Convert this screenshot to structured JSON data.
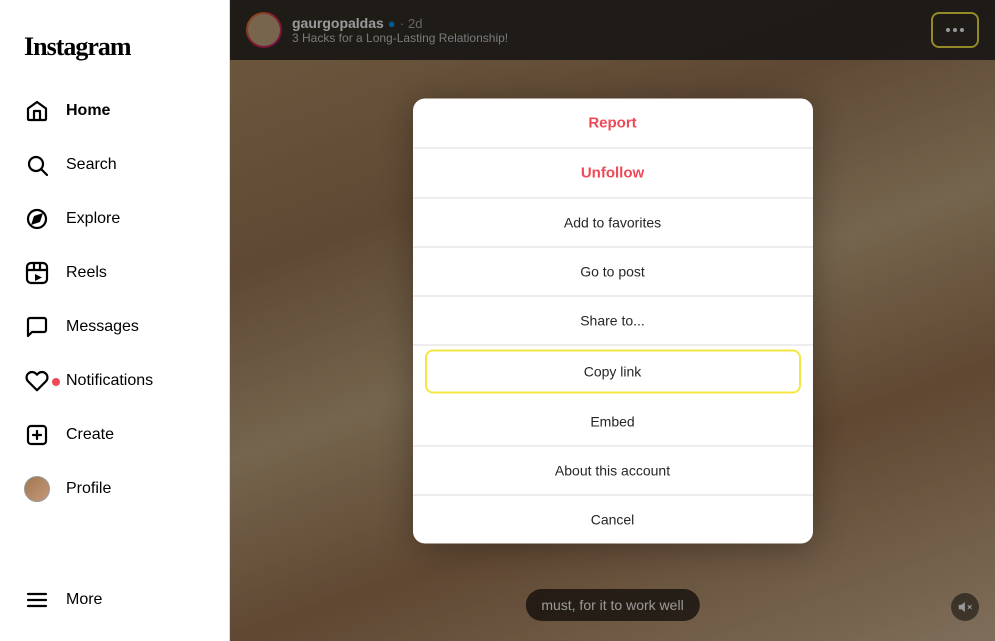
{
  "sidebar": {
    "logo": "Instagram",
    "items": [
      {
        "id": "home",
        "label": "Home",
        "icon": "home-icon",
        "active": true
      },
      {
        "id": "search",
        "label": "Search",
        "icon": "search-icon",
        "active": false
      },
      {
        "id": "explore",
        "label": "Explore",
        "icon": "explore-icon",
        "active": false
      },
      {
        "id": "reels",
        "label": "Reels",
        "icon": "reels-icon",
        "active": false
      },
      {
        "id": "messages",
        "label": "Messages",
        "icon": "messages-icon",
        "active": false
      },
      {
        "id": "notifications",
        "label": "Notifications",
        "icon": "notifications-icon",
        "active": false,
        "badge": true
      },
      {
        "id": "create",
        "label": "Create",
        "icon": "create-icon",
        "active": false
      },
      {
        "id": "profile",
        "label": "Profile",
        "icon": "profile-icon",
        "active": false
      }
    ],
    "more": {
      "label": "More",
      "icon": "more-icon"
    }
  },
  "post": {
    "username": "gaurgopaldas",
    "verified": true,
    "time": "2d",
    "caption_preview": "3 Hacks for a Long-Lasting Relationship!",
    "caption_overlay": "must, for it to work well"
  },
  "modal": {
    "items": [
      {
        "id": "report",
        "label": "Report",
        "type": "report"
      },
      {
        "id": "unfollow",
        "label": "Unfollow",
        "type": "unfollow"
      },
      {
        "id": "add-to-favorites",
        "label": "Add to favorites",
        "type": "normal"
      },
      {
        "id": "go-to-post",
        "label": "Go to post",
        "type": "normal"
      },
      {
        "id": "share-to",
        "label": "Share to...",
        "type": "normal"
      },
      {
        "id": "copy-link",
        "label": "Copy link",
        "type": "copy-link"
      },
      {
        "id": "embed",
        "label": "Embed",
        "type": "normal"
      },
      {
        "id": "about-this-account",
        "label": "About this account",
        "type": "normal"
      },
      {
        "id": "cancel",
        "label": "Cancel",
        "type": "normal"
      }
    ]
  }
}
